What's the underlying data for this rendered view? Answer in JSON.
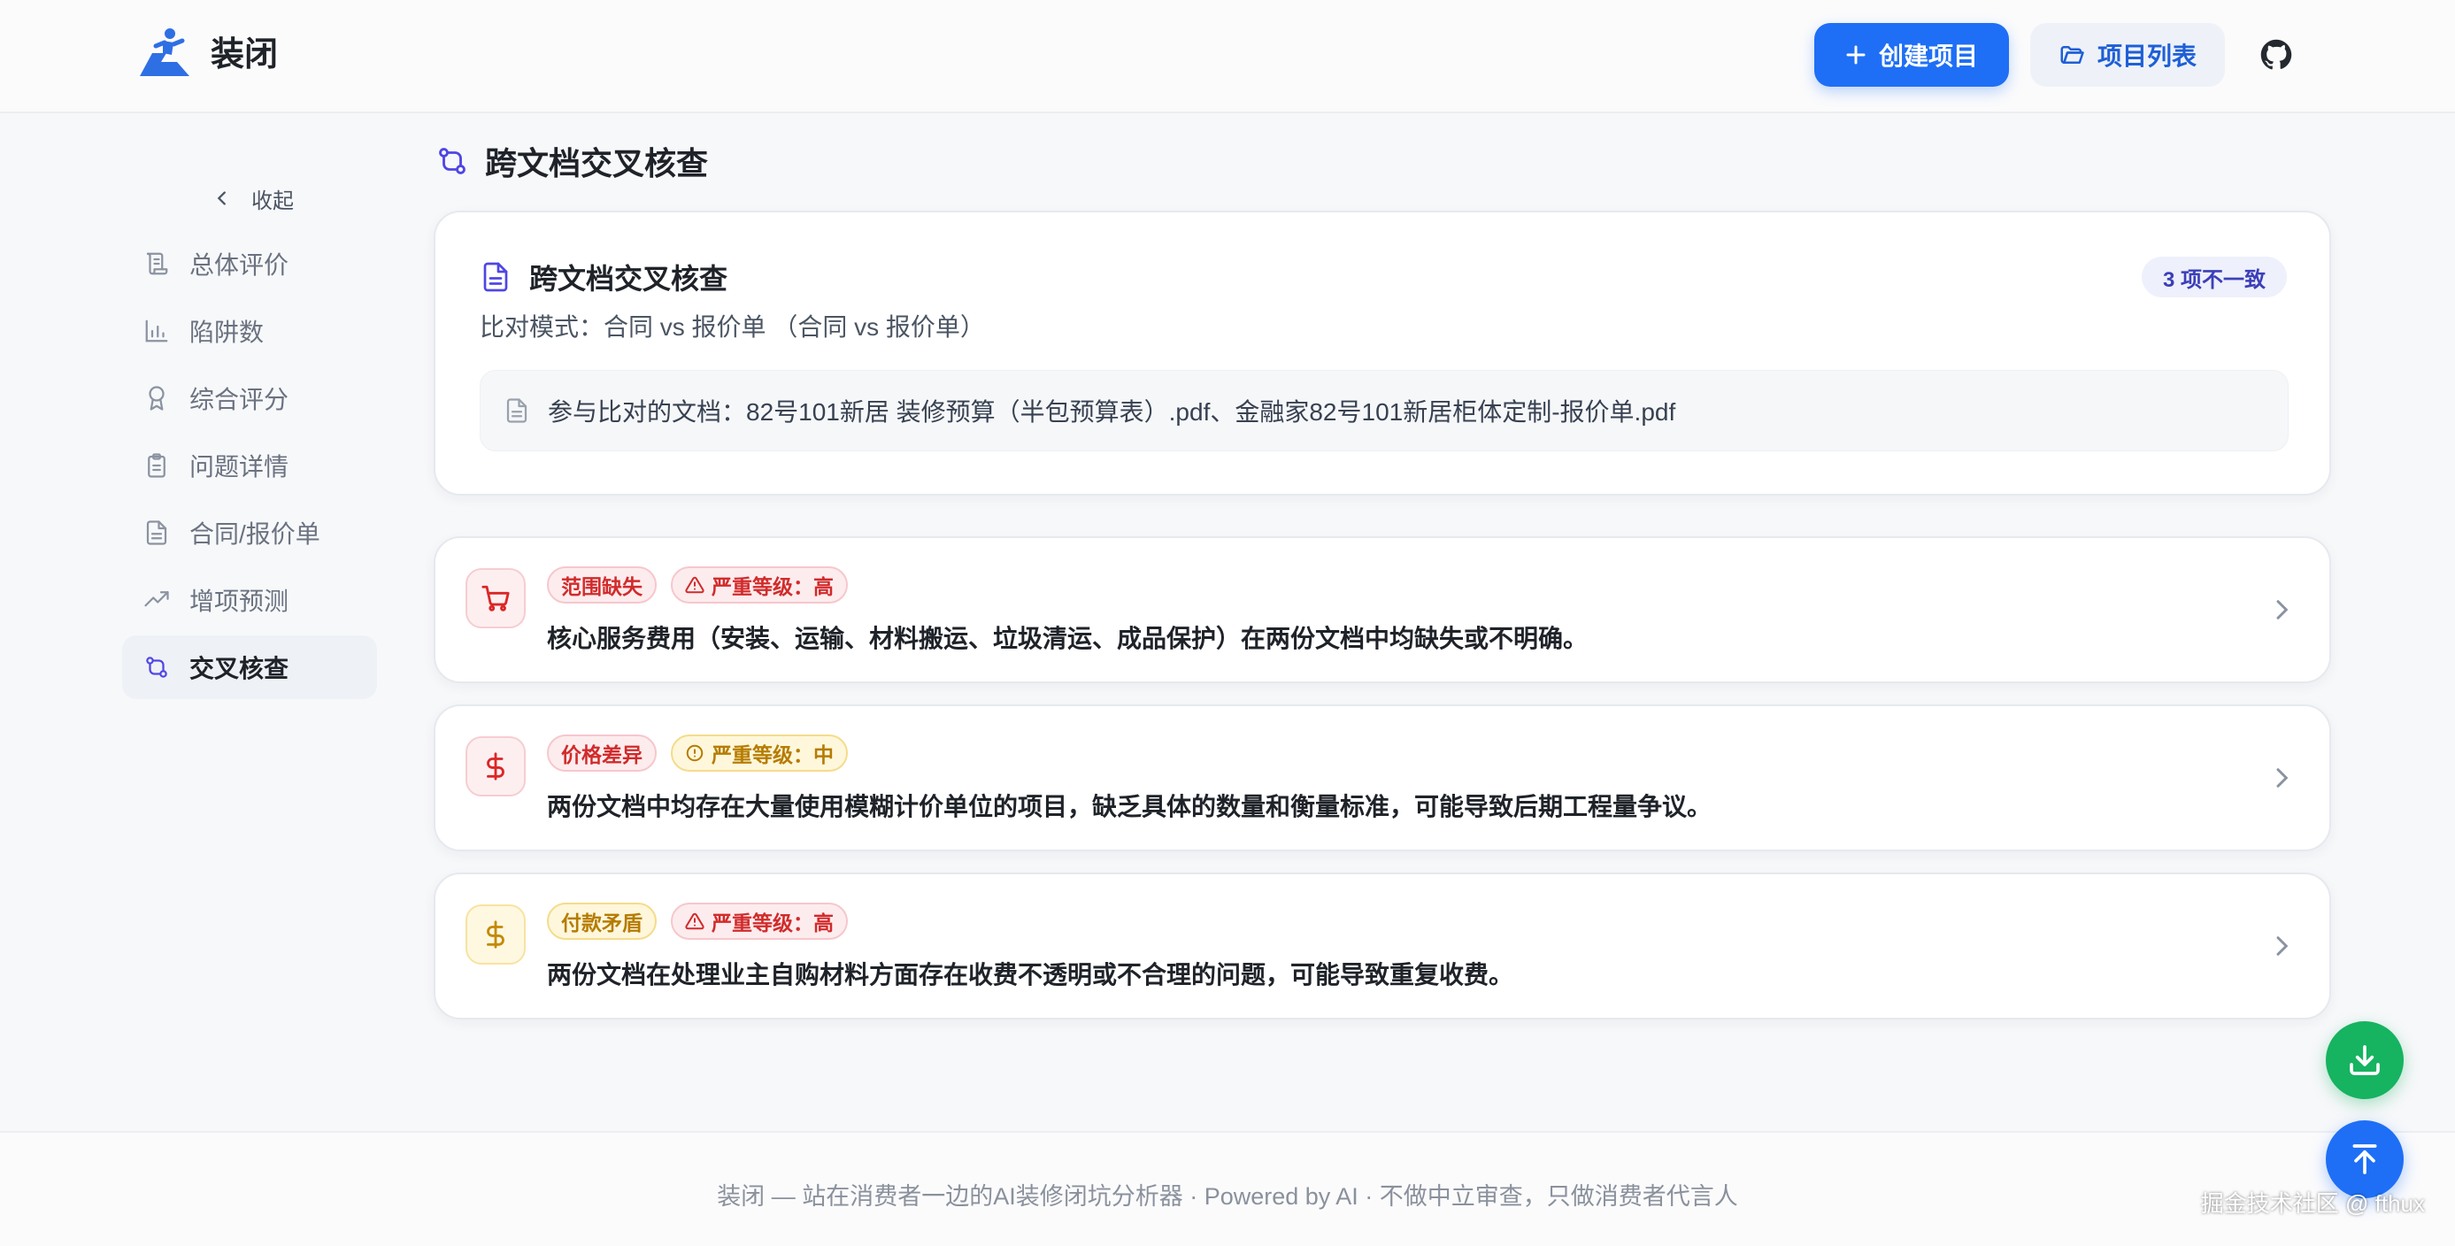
{
  "header": {
    "brand": "装闭",
    "create_button": "创建项目",
    "list_button": "项目列表"
  },
  "sidebar": {
    "collapse_label": "收起",
    "items": [
      {
        "label": "总体评价",
        "icon": "scroll-icon"
      },
      {
        "label": "陷阱数",
        "icon": "bar-chart-icon"
      },
      {
        "label": "综合评分",
        "icon": "award-icon"
      },
      {
        "label": "问题详情",
        "icon": "clipboard-icon"
      },
      {
        "label": "合同/报价单",
        "icon": "document-icon"
      },
      {
        "label": "增项预测",
        "icon": "trending-up-icon"
      },
      {
        "label": "交叉核查",
        "icon": "git-compare-icon",
        "active": true
      }
    ]
  },
  "main": {
    "page_title": "跨文档交叉核查",
    "summary": {
      "title": "跨文档交叉核查",
      "mode": "比对模式：合同 vs 报价单 （合同 vs 报价单）",
      "badge": "3 项不一致",
      "docs": "参与比对的文档：82号101新居 装修预算（半包预算表）.pdf、金融家82号101新居柜体定制-报价单.pdf"
    },
    "issues": [
      {
        "category": "范围缺失",
        "severity": "严重等级：高",
        "description": "核心服务费用（安装、运输、材料搬运、垃圾清运、成品保护）在两份文档中均缺失或不明确。",
        "icon": "cart-icon",
        "tone": "red"
      },
      {
        "category": "价格差异",
        "severity": "严重等级：中",
        "description": "两份文档中均存在大量使用模糊计价单位的项目，缺乏具体的数量和衡量标准，可能导致后期工程量争议。",
        "icon": "dollar-icon",
        "tone": "red"
      },
      {
        "category": "付款矛盾",
        "severity": "严重等级：高",
        "description": "两份文档在处理业主自购材料方面存在收费不透明或不合理的问题，可能导致重复收费。",
        "icon": "dollar-icon",
        "tone": "yellow"
      }
    ]
  },
  "footer": {
    "text": "装闭 — 站在消费者一边的AI装修闭坑分析器 · Powered by AI · 不做中立审查，只做消费者代言人"
  },
  "watermark": "掘金技术社区 @ fthux",
  "colors": {
    "primary": "#1e6ff5",
    "success": "#16b360",
    "danger": "#d12b2b",
    "warning": "#b57c00"
  }
}
